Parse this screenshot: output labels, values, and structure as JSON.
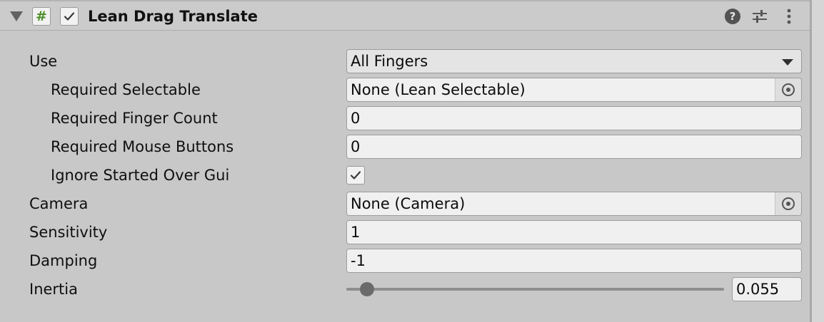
{
  "component": {
    "title": "Lean Drag Translate",
    "script_icon_glyph": "#",
    "enabled": true,
    "header_icons": [
      "help-icon",
      "preset-icon",
      "context-menu-icon"
    ],
    "help_glyph": "?"
  },
  "fields": {
    "use": {
      "label": "Use",
      "value": "All Fingers"
    },
    "required_selectable": {
      "label": "Required Selectable",
      "value": "None (Lean Selectable)"
    },
    "required_finger_count": {
      "label": "Required Finger Count",
      "value": "0"
    },
    "required_mouse_buttons": {
      "label": "Required Mouse Buttons",
      "value": "0"
    },
    "ignore_started_over_gui": {
      "label": "Ignore Started Over Gui",
      "checked": true
    },
    "camera": {
      "label": "Camera",
      "value": "None (Camera)"
    },
    "sensitivity": {
      "label": "Sensitivity",
      "value": "1"
    },
    "damping": {
      "label": "Damping",
      "value": "-1"
    },
    "inertia": {
      "label": "Inertia",
      "value": "0.055",
      "slider_fraction": 0.055
    }
  },
  "colors": {
    "panel_bg": "#c8c8c8",
    "field_bg": "#f0f0f0",
    "script_icon": "#4b8f2a"
  }
}
